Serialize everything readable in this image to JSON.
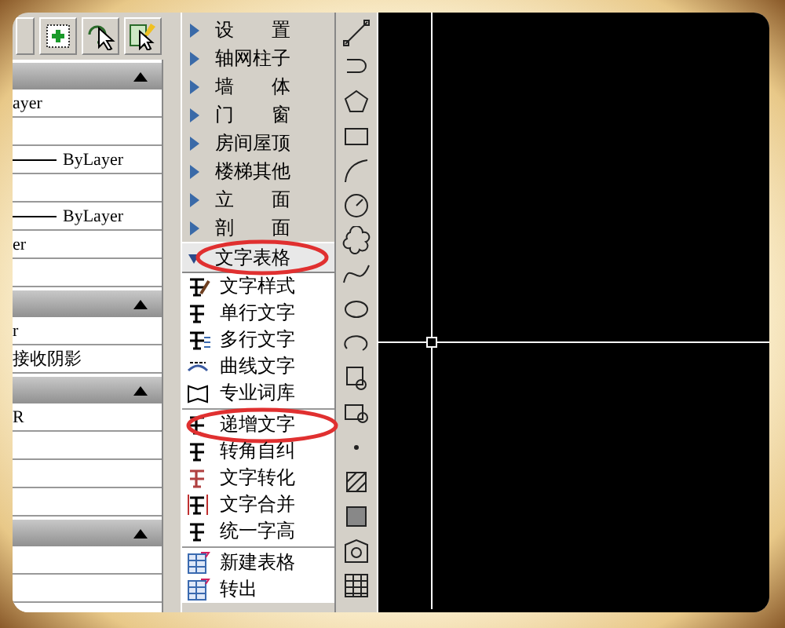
{
  "properties_panel": {
    "sections": [
      {
        "expanded": true,
        "rows": [
          {
            "kind": "text",
            "text": "ayer"
          },
          {
            "kind": "empty"
          },
          {
            "kind": "linetype",
            "text": "ByLayer"
          },
          {
            "kind": "empty"
          },
          {
            "kind": "linetype",
            "text": "ByLayer"
          },
          {
            "kind": "text",
            "text": "er"
          },
          {
            "kind": "empty"
          }
        ]
      },
      {
        "expanded": true,
        "rows": [
          {
            "kind": "text",
            "text": "r"
          },
          {
            "kind": "text",
            "text": "接收阴影"
          }
        ]
      },
      {
        "expanded": true,
        "rows": [
          {
            "kind": "text",
            "text": "R"
          },
          {
            "kind": "empty"
          },
          {
            "kind": "empty"
          },
          {
            "kind": "empty"
          }
        ]
      },
      {
        "expanded": true,
        "rows": [
          {
            "kind": "empty"
          },
          {
            "kind": "empty"
          }
        ]
      }
    ]
  },
  "menu": {
    "items": [
      {
        "label": "设置",
        "expanded": false,
        "circled": false
      },
      {
        "label": "轴网柱子",
        "expanded": false,
        "circled": false
      },
      {
        "label": "墙体",
        "expanded": false,
        "circled": false
      },
      {
        "label": "门窗",
        "expanded": false,
        "circled": false
      },
      {
        "label": "房间屋顶",
        "expanded": false,
        "circled": false
      },
      {
        "label": "楼梯其他",
        "expanded": false,
        "circled": false
      },
      {
        "label": "立面",
        "expanded": false,
        "circled": false
      },
      {
        "label": "剖面",
        "expanded": false,
        "circled": false
      },
      {
        "label": "文字表格",
        "expanded": true,
        "circled": true,
        "children": [
          {
            "label": "文字样式",
            "separator_before": false,
            "circled": false
          },
          {
            "label": "单行文字",
            "separator_before": false,
            "circled": false
          },
          {
            "label": "多行文字",
            "separator_before": false,
            "circled": false
          },
          {
            "label": "曲线文字",
            "separator_before": false,
            "circled": false
          },
          {
            "label": "专业词库",
            "separator_before": false,
            "circled": false
          },
          {
            "label": "递增文字",
            "separator_before": true,
            "circled": true
          },
          {
            "label": "转角自纠",
            "separator_before": false,
            "circled": false
          },
          {
            "label": "文字转化",
            "separator_before": false,
            "circled": false
          },
          {
            "label": "文字合并",
            "separator_before": false,
            "circled": false
          },
          {
            "label": "统一字高",
            "separator_before": false,
            "circled": false
          },
          {
            "label": "新建表格",
            "separator_before": true,
            "circled": false
          },
          {
            "label": "转出",
            "separator_before": false,
            "circled": false
          }
        ]
      }
    ]
  }
}
